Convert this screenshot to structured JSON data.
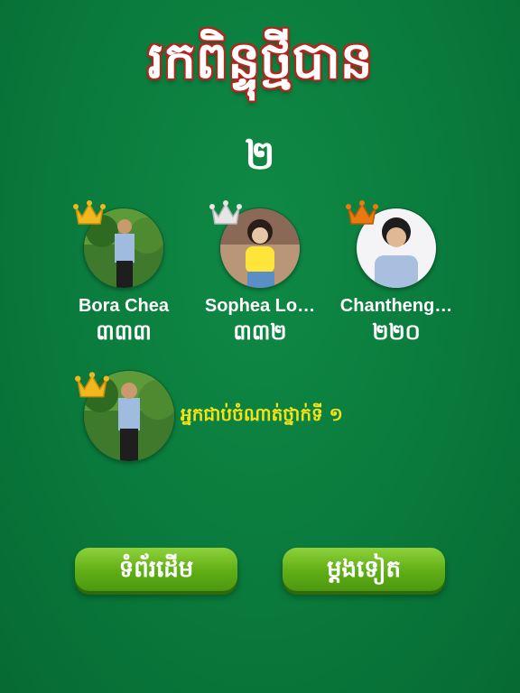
{
  "header": {
    "title": "រកពិន្ទុថ្មីបាន"
  },
  "level": "២",
  "players": [
    {
      "name": "Bora Chea",
      "score": "៣៣៣",
      "crown_color": "#f0b81c",
      "avatar_icon": "person-photo"
    },
    {
      "name": "Sophea Lo…",
      "score": "៣៣២",
      "crown_color": "#e6e6e6",
      "avatar_icon": "person-photo"
    },
    {
      "name": "Chantheng…",
      "score": "២២០",
      "crown_color": "#e87a12",
      "avatar_icon": "person-photo"
    }
  ],
  "winner": {
    "label": "អ្នកជាប់ចំណាត់ថ្នាក់ទី ១",
    "crown_color": "#f0b81c"
  },
  "buttons": {
    "home_label": "ទំព័រដើម",
    "again_label": "ម្ដងទៀត"
  },
  "colors": {
    "background": "#0a7a3c",
    "title_outline": "#b3261e",
    "winner_text": "#f3e21a",
    "button": "#5fae15"
  }
}
